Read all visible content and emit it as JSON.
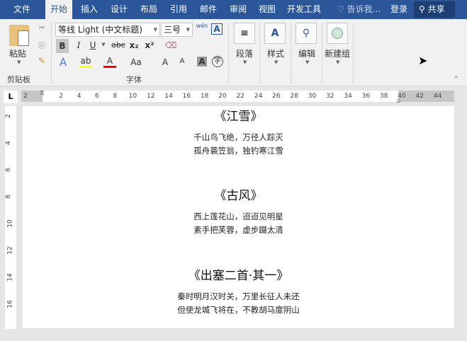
{
  "tabs": [
    "文件",
    "开始",
    "插入",
    "设计",
    "布局",
    "引用",
    "邮件",
    "审阅",
    "视图",
    "开发工具"
  ],
  "active_tab": "开始",
  "tell_me": "告诉我...",
  "login": "登录",
  "share": "共享",
  "clipboard": {
    "paste": "粘贴",
    "group_label": "剪贴板"
  },
  "font": {
    "name": "等线 Light (中文标题)",
    "size": "三号",
    "group_label": "字体",
    "bold": "B",
    "italic": "I",
    "underline": "U",
    "strike": "abc",
    "sub": "x₂",
    "sup": "x²",
    "phonetic": "wén",
    "change_case": "Aa",
    "grow": "A",
    "shrink": "A",
    "shading": "A",
    "enclose": "字",
    "highlight_color": "#ffff00",
    "font_color": "#ff0000"
  },
  "groups": [
    {
      "label": "段落"
    },
    {
      "label": "样式"
    },
    {
      "label": "编辑"
    },
    {
      "label": "新建组"
    }
  ],
  "ruler": {
    "corner": "L",
    "h_labels": [
      "2",
      "2",
      "4",
      "6",
      "8",
      "10",
      "12",
      "14",
      "16",
      "18",
      "20",
      "22",
      "24",
      "26",
      "28",
      "30",
      "32",
      "34",
      "36",
      "38",
      "40",
      "42",
      "44"
    ],
    "v_labels": [
      "2",
      "4",
      "6",
      "8",
      "10",
      "12",
      "14",
      "16"
    ]
  },
  "document": {
    "poems": [
      {
        "title": "《江雪》",
        "lines": [
          "千山鸟飞绝，万径人踪灭",
          "孤舟蓑笠翁，独钓寒江雪"
        ]
      },
      {
        "title": "《古风》",
        "lines": [
          "西上莲花山，迢迢见明星",
          "素手把芙蓉，虚步蹑太清"
        ]
      },
      {
        "title": "《出塞二首·其一》",
        "lines": [
          "秦时明月汉时关，万里长征人未还",
          "但使龙城飞将在，不教胡马度阴山"
        ]
      }
    ]
  }
}
